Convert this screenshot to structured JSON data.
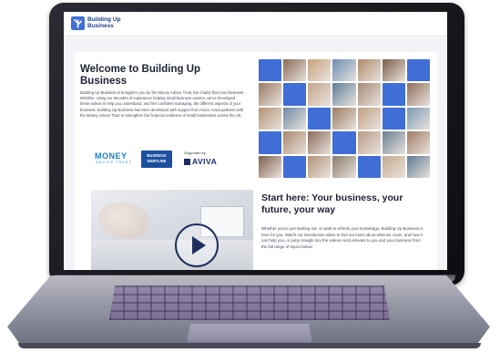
{
  "header": {
    "logo_text": "Building Up Business"
  },
  "welcome": {
    "title": "Welcome to Building Up Business",
    "body": "Building Up Business is brought to you by the Money Advice Trust, the charity that runs Business Debtline. Using our decades of experience helping small business owners, we've developed these videos to help you understand, and feel confident managing, the different aspects of your business. Building Up Business has been developed with support from Aviva. Aviva partners with the Money Advice Trust to strengthen the financial resilience of small businesses across the UK."
  },
  "partners": {
    "money_advice": "MONEY",
    "money_advice_sub": "ADVICE TRUST",
    "debtline": "BUSINESS DEBTLINE",
    "supported_by": "Supported by",
    "aviva": "AVIVA"
  },
  "start": {
    "title": "Start here: Your business, your future, your way",
    "body": "Whether you're just starting out, or want to refresh your knowledge, Building Up Business is here for you. Watch our introduction video to find out more about what we cover, and how it can help you, or jump straight into the videos most relevant to you and your business from the full range of topics below."
  },
  "mosaic_colors": [
    "#3f6fd6",
    "#8a6a55",
    "#c9a27e",
    "#6b8db0",
    "#b08a6a",
    "#7c5a48",
    "#3f6fd6",
    "#9a7a62",
    "#3f6fd6",
    "#c3a58c",
    "#5e7f9a",
    "#a48b78",
    "#3f6fd6",
    "#8e6e5c",
    "#b39273",
    "#6d8aa6",
    "#3f6fd6",
    "#9c7b64",
    "#c0a084",
    "#3f6fd6",
    "#7a9ab4",
    "#3f6fd6",
    "#a8876c",
    "#8d6a57",
    "#3f6fd6",
    "#b89c86",
    "#6a7f92",
    "#a07c63",
    "#7e5f4c",
    "#3f6fd6",
    "#b49478",
    "#8b7a6c",
    "#3f6fd6",
    "#c5a98f",
    "#5d7a94"
  ]
}
